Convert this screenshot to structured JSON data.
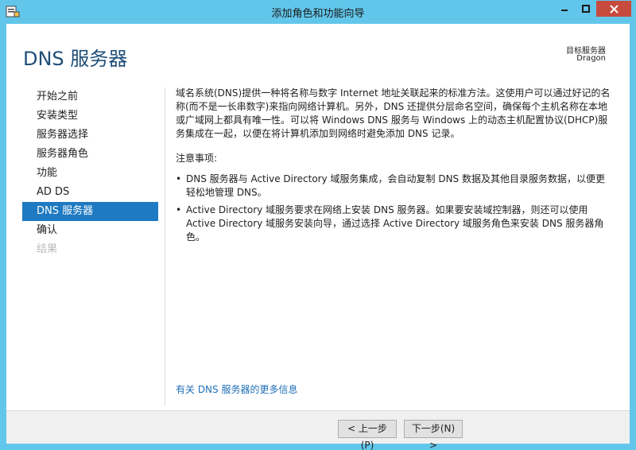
{
  "window": {
    "title": "添加角色和功能向导"
  },
  "header": {
    "page_title": "DNS 服务器",
    "target_label": "目标服务器",
    "target_value": "Dragon"
  },
  "nav": {
    "items": [
      {
        "label": "开始之前"
      },
      {
        "label": "安装类型"
      },
      {
        "label": "服务器选择"
      },
      {
        "label": "服务器角色"
      },
      {
        "label": "功能"
      },
      {
        "label": "AD DS"
      },
      {
        "label": "DNS 服务器"
      },
      {
        "label": "确认"
      },
      {
        "label": "结果"
      }
    ]
  },
  "content": {
    "intro": "域名系统(DNS)提供一种将名称与数字 Internet 地址关联起来的标准方法。这使用户可以通过好记的名称(而不是一长串数字)来指向网络计算机。另外，DNS 还提供分层命名空间，确保每个主机名称在本地或广域网上都具有唯一性。可以将 Windows DNS 服务与 Windows 上的动态主机配置协议(DHCP)服务集成在一起，以便在将计算机添加到网络时避免添加 DNS 记录。",
    "notes_title": "注意事项:",
    "bullets": [
      "DNS 服务器与 Active Directory 域服务集成，会自动复制 DNS 数据及其他目录服务数据，以便更轻松地管理 DNS。",
      "Active Directory 域服务要求在网络上安装 DNS 服务器。如果要安装域控制器，则还可以使用 Active Directory 域服务安装向导，通过选择 Active Directory 域服务角色来安装 DNS 服务器角色。"
    ],
    "more_link": "有关 DNS 服务器的更多信息"
  },
  "footer": {
    "prev": "< 上一步(P)",
    "next": "下一步(N) >"
  },
  "colors": {
    "titlebar": "#62c6ea",
    "accent": "#1e7ac2",
    "link": "#1e6fb8",
    "close": "#c74a3f"
  }
}
